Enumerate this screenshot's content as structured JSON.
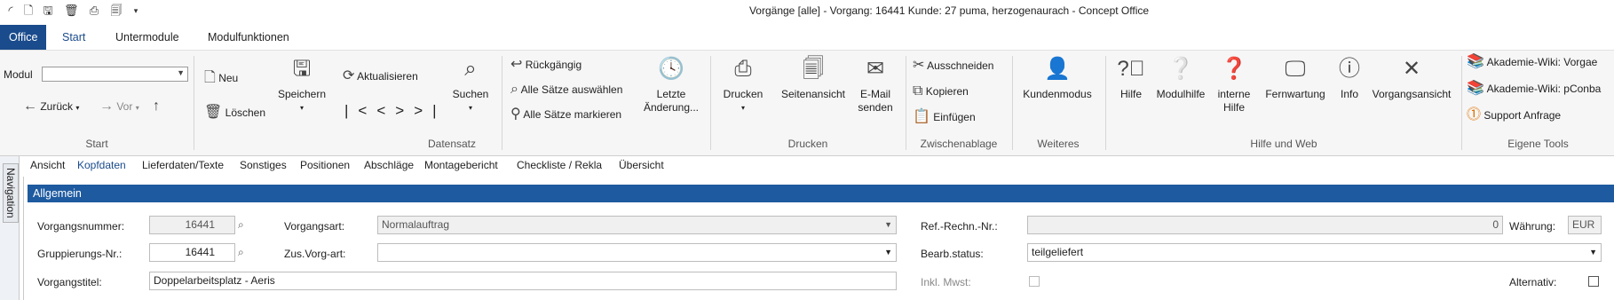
{
  "titlebar": {
    "title": "Vorgänge [alle] - Vorgang: 16441 Kunde: 27 puma, herzogenaurach - Concept Office",
    "quick_access_icons": [
      "app-logo-icon",
      "new-file-icon",
      "save-icon",
      "delete-icon",
      "print-icon",
      "print-preview-icon",
      "customize-arrow-icon"
    ]
  },
  "menu_tabs": [
    "Office",
    "Start",
    "Untermodule",
    "Modulfunktionen"
  ],
  "ribbon": {
    "start": {
      "modul_label": "Modul",
      "modul_value": "",
      "back_label": "Zurück",
      "forward_label": "Vor",
      "group_label": "Start"
    },
    "datensatz": {
      "new_label": "Neu",
      "delete_label": "Löschen",
      "save_label": "Speichern",
      "refresh_label": "Aktualisieren",
      "search_label": "Suchen",
      "undo_label": "Rückgängig",
      "select_all_label": "Alle Sätze auswählen",
      "mark_all_label": "Alle Sätze markieren",
      "last_changes_label": "Letzte Änderung...",
      "group_label": "Datensatz"
    },
    "drucken": {
      "print_label": "Drucken",
      "preview_label": "Seitenansicht",
      "email_label": "E-Mail senden",
      "group_label": "Drucken"
    },
    "zwischenablage": {
      "cut_label": "Ausschneiden",
      "copy_label": "Kopieren",
      "paste_label": "Einfügen",
      "group_label": "Zwischenablage"
    },
    "weiteres": {
      "customer_mode_label": "Kundenmodus",
      "group_label": "Weiteres"
    },
    "hilfe": {
      "help_label": "Hilfe",
      "module_help_label": "Modulhilfe",
      "internal_help_label": "interne Hilfe",
      "remote_label": "Fernwartung",
      "info_label": "Info",
      "process_view_label": "Vorgangsansicht",
      "group_label": "Hilfe und Web"
    },
    "eigene": {
      "wiki1_label": "Akademie-Wiki: Vorgae",
      "wiki2_label": "Akademie-Wiki: pConba",
      "support_label": "Support Anfrage",
      "group_label": "Eigene Tools"
    }
  },
  "nav_label": "Navigation",
  "detail_tabs": [
    "Ansicht",
    "Kopfdaten",
    "Lieferdaten/Texte",
    "Sonstiges",
    "Positionen",
    "Abschläge",
    "Montagebericht",
    "Checkliste / Rekla",
    "Übersicht"
  ],
  "section_title": "Allgemein",
  "form": {
    "vorgangsnummer_label": "Vorgangsnummer:",
    "vorgangsnummer_value": "16441",
    "gruppierung_label": "Gruppierungs-Nr.:",
    "gruppierung_value": "16441",
    "vorgangstitel_label": "Vorgangstitel:",
    "vorgangstitel_value": "Doppelarbeitsplatz - Aeris",
    "vorgangsart_label": "Vorgangsart:",
    "vorgangsart_value": "Normalauftrag",
    "zusvorgart_label": "Zus.Vorg-art:",
    "zusvorgart_value": "",
    "refrechn_label": "Ref.-Rechn.-Nr.:",
    "refrechn_value": "0",
    "waehrung_label": "Währung:",
    "waehrung_value": "EUR",
    "bearbstatus_label": "Bearb.status:",
    "bearbstatus_value": "teilgeliefert",
    "inklmwst_label": "Inkl. Mwst:",
    "alternativ_label": "Alternativ:"
  }
}
